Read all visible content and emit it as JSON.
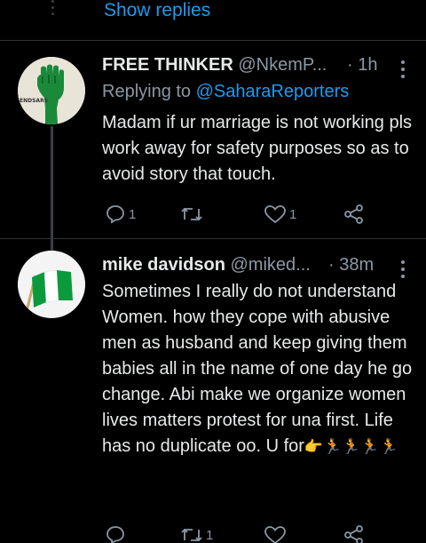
{
  "show_replies": {
    "label": "Show replies"
  },
  "tweets": [
    {
      "name": "FREE THINKER",
      "handle": "@NkemP...",
      "time": "1h",
      "replying_prefix": "Replying to",
      "replying_to": "@SaharaReporters",
      "text": "Madam if ur marriage is not working pls work away for safety purposes so as to avoid story that touch.",
      "avatar_label": "ENDSARS",
      "replies": "1",
      "retweets": "",
      "likes": "1"
    },
    {
      "name": "mike davidson",
      "handle": "@miked...",
      "time": "38m",
      "text": "Sometimes I really do not understand Women. how they cope with abusive men as husband and keep giving them babies all in the name of one day he go change. Abi make we organize women lives matters protest for una first. Life has no duplicate oo. U for",
      "emojis": "👉🏃🏃🏃🏃",
      "replies": "",
      "retweets": "1",
      "likes": ""
    }
  ],
  "colors": {
    "background": "#000000",
    "text": "#e7e9ea",
    "muted": "#8b98a5",
    "accent": "#1d9bf0",
    "divider": "#2f3336"
  },
  "icons": [
    "more-vertical-icon",
    "reply-icon",
    "retweet-icon",
    "like-icon",
    "share-icon"
  ]
}
